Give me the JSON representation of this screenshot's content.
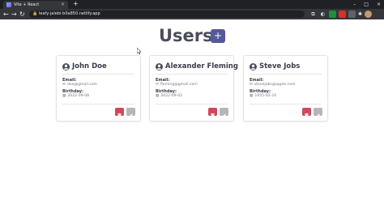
{
  "browser": {
    "tab_title": "Vite + React",
    "tab_close": "×",
    "new_tab": "+",
    "url": "leafy-jalebi-b0a850.netlify.app",
    "window_controls": [
      "–",
      "□",
      "×"
    ],
    "nav": {
      "back": "←",
      "forward": "→",
      "reload": "↻"
    },
    "lock": "🔒"
  },
  "page": {
    "title": "Users",
    "add_button": "+"
  },
  "users": [
    {
      "name": "John Doe",
      "email_label": "Email:",
      "email": "doe@gmail.com",
      "birthday_label": "Birthday:",
      "birthday": "2022-09-08"
    },
    {
      "name": "Alexander Fleming",
      "email_label": "Email:",
      "email": "fleming@gmail.com",
      "birthday_label": "Birthday:",
      "birthday": "2022-09-02"
    },
    {
      "name": "Steve Jobs",
      "email_label": "Email:",
      "email": "stevejobs@apple.com",
      "birthday_label": "Birthday:",
      "birthday": "1955-02-24"
    }
  ],
  "icons": {
    "user": "user-circle-icon",
    "email": "envelope-icon",
    "birthday": "calendar-icon",
    "delete": "trash-icon",
    "edit": "pencil-icon"
  },
  "colors": {
    "accent": "#55599b",
    "title": "#4a4d5a",
    "delete": "#d0485b",
    "edit": "#b6b6b6"
  }
}
